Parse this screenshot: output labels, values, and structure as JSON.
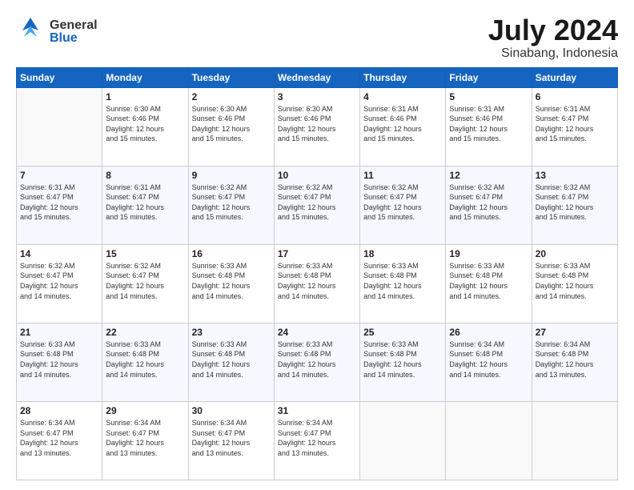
{
  "header": {
    "logo": {
      "general": "General",
      "blue": "Blue"
    },
    "title": "July 2024",
    "location": "Sinabang, Indonesia"
  },
  "days_of_week": [
    "Sunday",
    "Monday",
    "Tuesday",
    "Wednesday",
    "Thursday",
    "Friday",
    "Saturday"
  ],
  "weeks": [
    [
      {
        "day": "",
        "empty": true
      },
      {
        "day": "1",
        "sunrise": "6:30 AM",
        "sunset": "6:46 PM",
        "daylight": "12 hours and 15 minutes."
      },
      {
        "day": "2",
        "sunrise": "6:30 AM",
        "sunset": "6:46 PM",
        "daylight": "12 hours and 15 minutes."
      },
      {
        "day": "3",
        "sunrise": "6:30 AM",
        "sunset": "6:46 PM",
        "daylight": "12 hours and 15 minutes."
      },
      {
        "day": "4",
        "sunrise": "6:31 AM",
        "sunset": "6:46 PM",
        "daylight": "12 hours and 15 minutes."
      },
      {
        "day": "5",
        "sunrise": "6:31 AM",
        "sunset": "6:46 PM",
        "daylight": "12 hours and 15 minutes."
      },
      {
        "day": "6",
        "sunrise": "6:31 AM",
        "sunset": "6:47 PM",
        "daylight": "12 hours and 15 minutes."
      }
    ],
    [
      {
        "day": "7",
        "sunrise": "6:31 AM",
        "sunset": "6:47 PM",
        "daylight": "12 hours and 15 minutes."
      },
      {
        "day": "8",
        "sunrise": "6:31 AM",
        "sunset": "6:47 PM",
        "daylight": "12 hours and 15 minutes."
      },
      {
        "day": "9",
        "sunrise": "6:32 AM",
        "sunset": "6:47 PM",
        "daylight": "12 hours and 15 minutes."
      },
      {
        "day": "10",
        "sunrise": "6:32 AM",
        "sunset": "6:47 PM",
        "daylight": "12 hours and 15 minutes."
      },
      {
        "day": "11",
        "sunrise": "6:32 AM",
        "sunset": "6:47 PM",
        "daylight": "12 hours and 15 minutes."
      },
      {
        "day": "12",
        "sunrise": "6:32 AM",
        "sunset": "6:47 PM",
        "daylight": "12 hours and 15 minutes."
      },
      {
        "day": "13",
        "sunrise": "6:32 AM",
        "sunset": "6:47 PM",
        "daylight": "12 hours and 15 minutes."
      }
    ],
    [
      {
        "day": "14",
        "sunrise": "6:32 AM",
        "sunset": "6:47 PM",
        "daylight": "12 hours and 14 minutes."
      },
      {
        "day": "15",
        "sunrise": "6:32 AM",
        "sunset": "6:47 PM",
        "daylight": "12 hours and 14 minutes."
      },
      {
        "day": "16",
        "sunrise": "6:33 AM",
        "sunset": "6:48 PM",
        "daylight": "12 hours and 14 minutes."
      },
      {
        "day": "17",
        "sunrise": "6:33 AM",
        "sunset": "6:48 PM",
        "daylight": "12 hours and 14 minutes."
      },
      {
        "day": "18",
        "sunrise": "6:33 AM",
        "sunset": "6:48 PM",
        "daylight": "12 hours and 14 minutes."
      },
      {
        "day": "19",
        "sunrise": "6:33 AM",
        "sunset": "6:48 PM",
        "daylight": "12 hours and 14 minutes."
      },
      {
        "day": "20",
        "sunrise": "6:33 AM",
        "sunset": "6:48 PM",
        "daylight": "12 hours and 14 minutes."
      }
    ],
    [
      {
        "day": "21",
        "sunrise": "6:33 AM",
        "sunset": "6:48 PM",
        "daylight": "12 hours and 14 minutes."
      },
      {
        "day": "22",
        "sunrise": "6:33 AM",
        "sunset": "6:48 PM",
        "daylight": "12 hours and 14 minutes."
      },
      {
        "day": "23",
        "sunrise": "6:33 AM",
        "sunset": "6:48 PM",
        "daylight": "12 hours and 14 minutes."
      },
      {
        "day": "24",
        "sunrise": "6:33 AM",
        "sunset": "6:48 PM",
        "daylight": "12 hours and 14 minutes."
      },
      {
        "day": "25",
        "sunrise": "6:33 AM",
        "sunset": "6:48 PM",
        "daylight": "12 hours and 14 minutes."
      },
      {
        "day": "26",
        "sunrise": "6:34 AM",
        "sunset": "6:48 PM",
        "daylight": "12 hours and 14 minutes."
      },
      {
        "day": "27",
        "sunrise": "6:34 AM",
        "sunset": "6:48 PM",
        "daylight": "12 hours and 13 minutes."
      }
    ],
    [
      {
        "day": "28",
        "sunrise": "6:34 AM",
        "sunset": "6:47 PM",
        "daylight": "12 hours and 13 minutes."
      },
      {
        "day": "29",
        "sunrise": "6:34 AM",
        "sunset": "6:47 PM",
        "daylight": "12 hours and 13 minutes."
      },
      {
        "day": "30",
        "sunrise": "6:34 AM",
        "sunset": "6:47 PM",
        "daylight": "12 hours and 13 minutes."
      },
      {
        "day": "31",
        "sunrise": "6:34 AM",
        "sunset": "6:47 PM",
        "daylight": "12 hours and 13 minutes."
      },
      {
        "day": "",
        "empty": true
      },
      {
        "day": "",
        "empty": true
      },
      {
        "day": "",
        "empty": true
      }
    ]
  ],
  "daylight_label": "Daylight:",
  "sunrise_label": "Sunrise:",
  "sunset_label": "Sunset:"
}
